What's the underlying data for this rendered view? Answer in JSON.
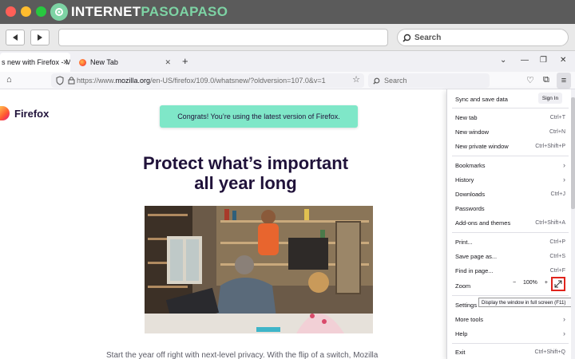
{
  "site_logo": {
    "text_main": "INTERNET",
    "text_accent": "PASOAPASO"
  },
  "outer_search": {
    "placeholder": "Search"
  },
  "tabs": [
    {
      "label": "s new with Firefox - More"
    },
    {
      "label": "New Tab"
    }
  ],
  "url": {
    "prefix": "https://www.",
    "domain": "mozilla.org",
    "path": "/en-US/firefox/109.0/whatsnew/?oldversion=107.0&v=1"
  },
  "search_bar": {
    "placeholder": "Search"
  },
  "page": {
    "brand": "Firefox",
    "congrats": "Congrats! You’re using the latest version of Firefox.",
    "headline_line1": "Protect what’s important",
    "headline_line2": "all year long",
    "body_text": "Start the year off right with next-level privacy. With the flip of a switch, Mozilla"
  },
  "menu": {
    "sync_label": "Sync and save data",
    "sign_in": "Sign In",
    "items": [
      {
        "label": "New tab",
        "shortcut": "Ctrl+T"
      },
      {
        "label": "New window",
        "shortcut": "Ctrl+N"
      },
      {
        "label": "New private window",
        "shortcut": "Ctrl+Shift+P"
      },
      {
        "label": "Bookmarks",
        "shortcut": ""
      },
      {
        "label": "History",
        "shortcut": ""
      },
      {
        "label": "Downloads",
        "shortcut": "Ctrl+J"
      },
      {
        "label": "Passwords",
        "shortcut": ""
      },
      {
        "label": "Add-ons and themes",
        "shortcut": "Ctrl+Shift+A"
      },
      {
        "label": "Print...",
        "shortcut": "Ctrl+P"
      },
      {
        "label": "Save page as...",
        "shortcut": "Ctrl+S"
      },
      {
        "label": "Find in page...",
        "shortcut": "Ctrl+F"
      },
      {
        "label": "Zoom",
        "shortcut": ""
      },
      {
        "label": "Settings",
        "shortcut": ""
      },
      {
        "label": "More tools",
        "shortcut": ""
      },
      {
        "label": "Help",
        "shortcut": ""
      },
      {
        "label": "Exit",
        "shortcut": "Ctrl+Shift+Q"
      }
    ],
    "zoom": {
      "minus": "−",
      "value": "100%",
      "plus": "+"
    },
    "fullscreen_tooltip": "Display the window in full screen (F11)"
  },
  "colors": {
    "congrats_bg": "#7fe7c8",
    "headline": "#20123a",
    "highlight": "#e0241c"
  }
}
